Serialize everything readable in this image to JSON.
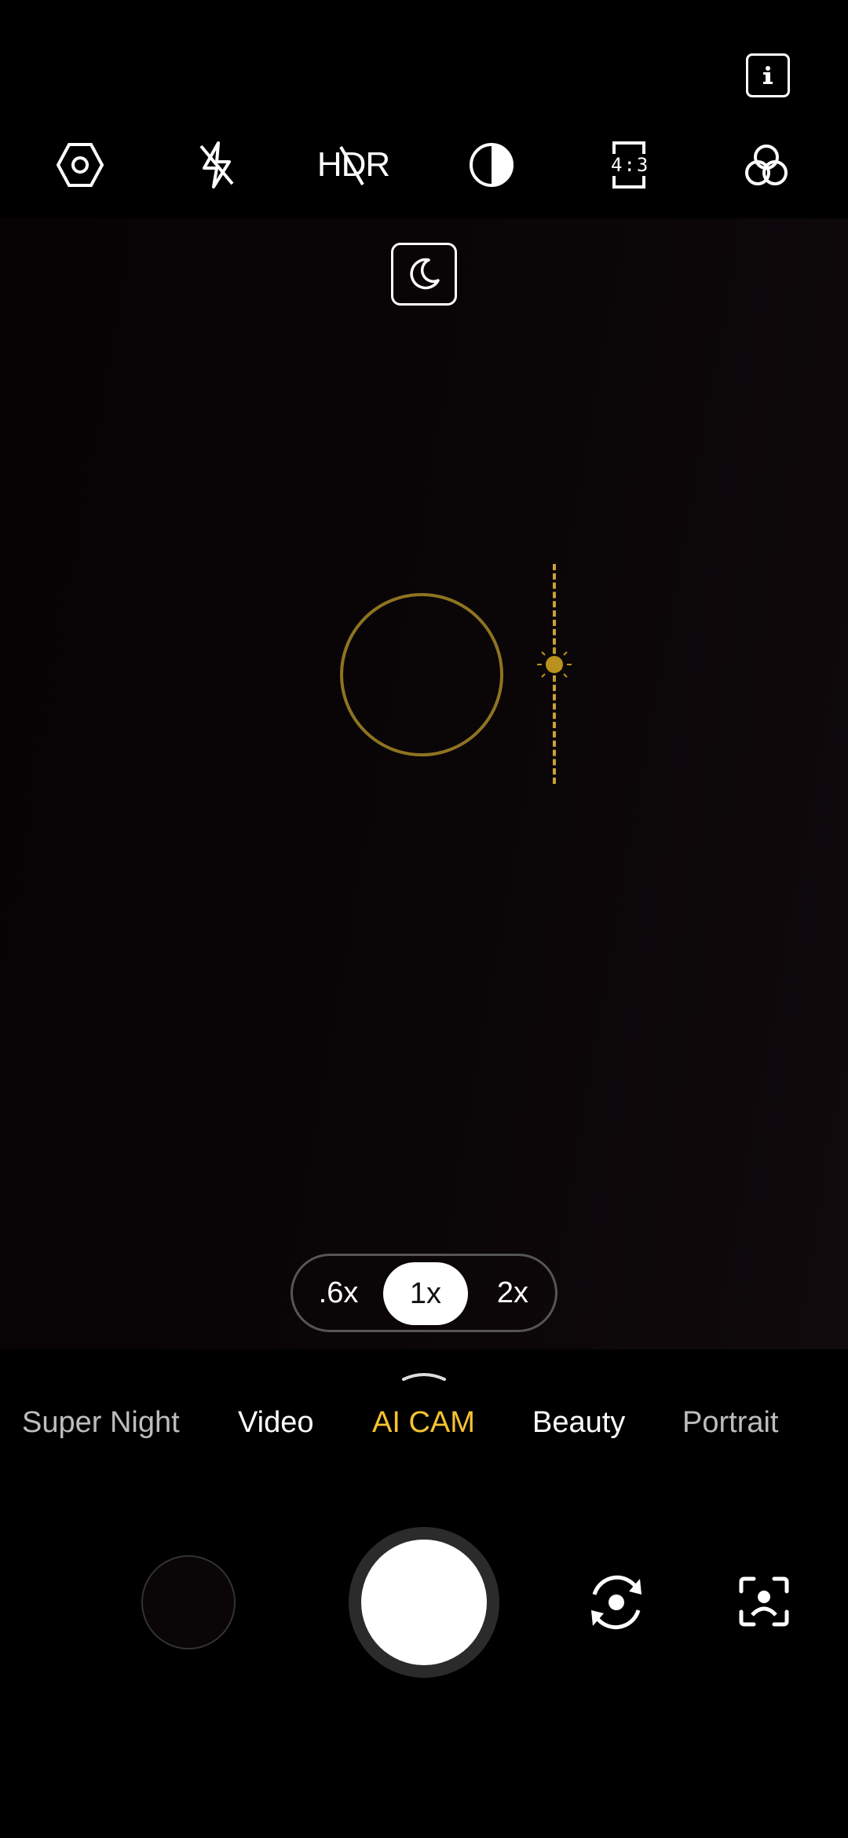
{
  "top": {
    "info_icon": "info-icon"
  },
  "toolbar": {
    "icons": [
      "settings-icon",
      "flash-off-icon",
      "hdr-off-icon",
      "contrast-icon",
      "aspect-ratio-icon",
      "filters-icon"
    ],
    "hdr_label": "HDR",
    "aspect_label": "4:3"
  },
  "viewfinder": {
    "night_badge_icon": "moon-icon",
    "focus_color": "#8e7421",
    "exposure_color": "#c9a03a"
  },
  "zoom": {
    "options": [
      ".6x",
      "1x",
      "2x"
    ],
    "selected": "1x"
  },
  "modes": {
    "items": [
      "Super Night",
      "Video",
      "AI CAM",
      "Beauty",
      "Portrait"
    ],
    "active": "AI CAM",
    "active_color": "#f5c330"
  },
  "controls": {
    "gallery_icon": "gallery-thumbnail",
    "shutter_icon": "shutter-button",
    "flip_icon": "flip-camera-icon",
    "lens_icon": "lens-scan-icon"
  }
}
